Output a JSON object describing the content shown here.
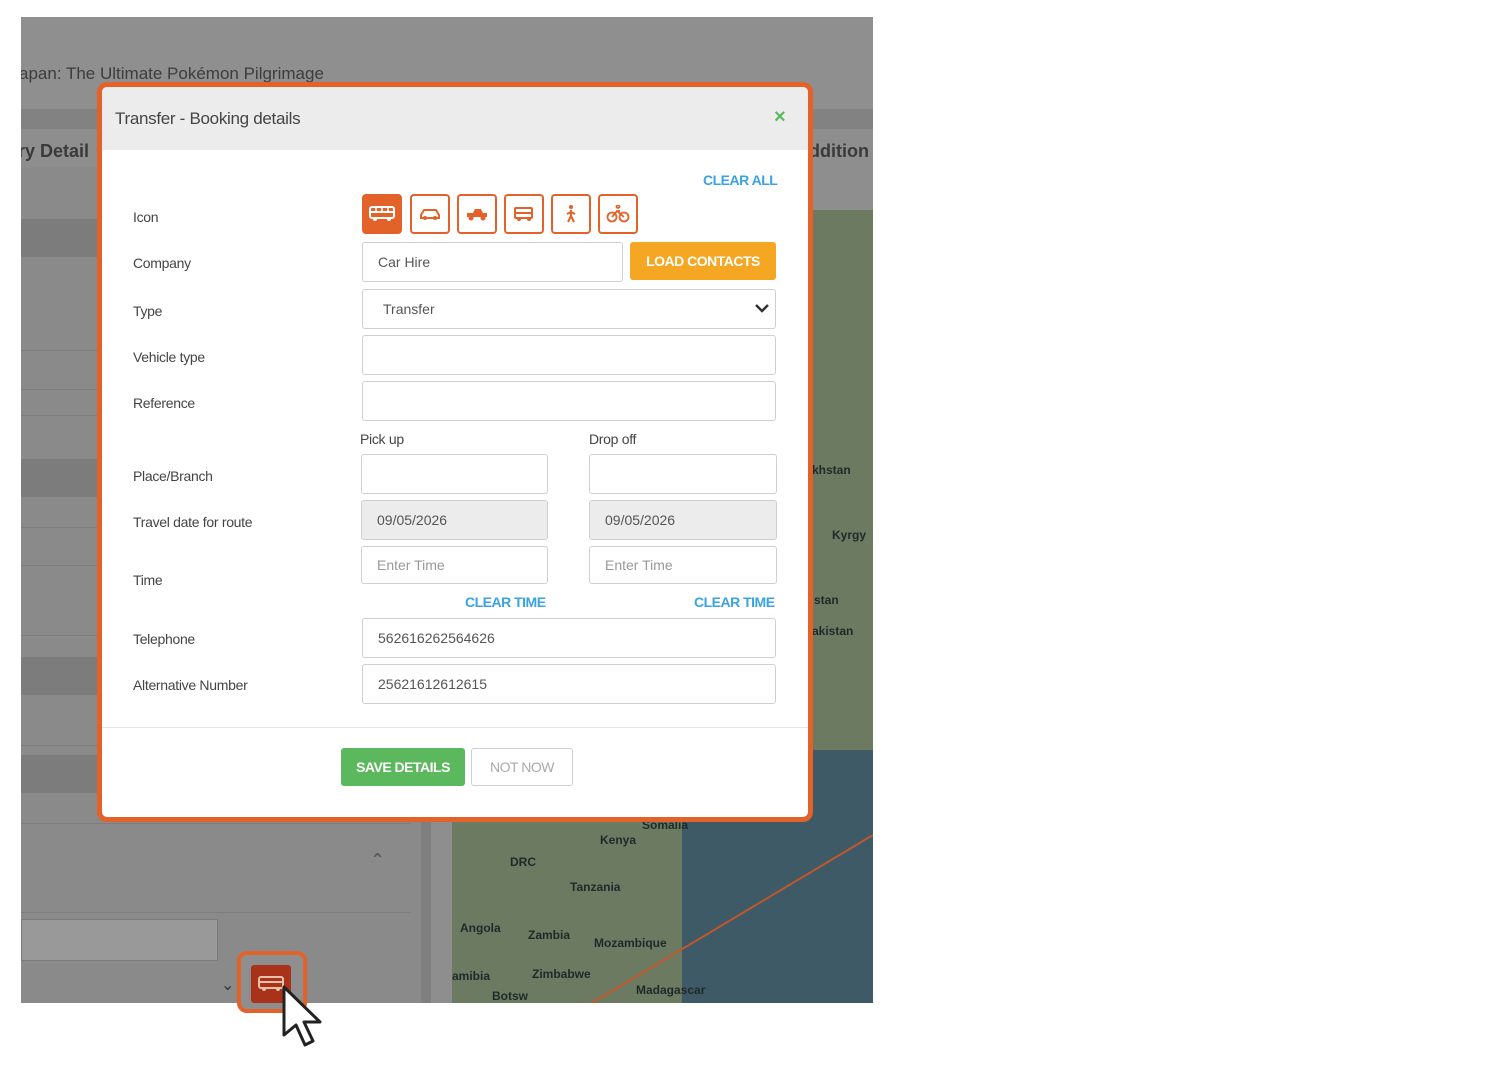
{
  "background": {
    "page_title": "apan: The Ultimate Pokémon Pilgrimage",
    "left_heading": "ry Detail",
    "right_heading": "ddition",
    "map_labels": [
      "khstan",
      "Kyrgy",
      "stan",
      "akistan",
      "Somalia",
      "Kenya",
      "DRC",
      "Tanzania",
      "Angola",
      "Zambia",
      "Mozambique",
      "amibia",
      "Zimbabwe",
      "Botsw",
      "Madagascar"
    ]
  },
  "modal": {
    "title": "Transfer - Booking details",
    "close_label": "×",
    "clear_all": "CLEAR ALL",
    "labels": {
      "icon": "Icon",
      "company": "Company",
      "type": "Type",
      "vehicle_type": "Vehicle type",
      "reference": "Reference",
      "pick_up": "Pick up",
      "drop_off": "Drop off",
      "place_branch": "Place/Branch",
      "travel_date": "Travel date for route",
      "time": "Time",
      "telephone": "Telephone",
      "alt_number": "Alternative Number"
    },
    "icons": [
      "bus-icon",
      "car-icon",
      "jeep-icon",
      "van-icon",
      "walk-icon",
      "bicycle-icon"
    ],
    "values": {
      "company": "Car Hire",
      "type": "Transfer",
      "vehicle_type": "",
      "reference": "",
      "pickup_place": "",
      "dropoff_place": "",
      "pickup_date": "09/05/2026",
      "dropoff_date": "09/05/2026",
      "pickup_time": "",
      "dropoff_time": "",
      "telephone": "562616262564626",
      "alt_number": "25621612612615"
    },
    "placeholders": {
      "time": "Enter Time"
    },
    "load_contacts": "LOAD CONTACTS",
    "clear_time": "CLEAR TIME",
    "save": "SAVE DETAILS",
    "not_now": "NOT NOW"
  },
  "colors": {
    "accent": "#e2622a",
    "save": "#5cb85c",
    "load": "#f5a623",
    "link": "#3ba3e0"
  }
}
